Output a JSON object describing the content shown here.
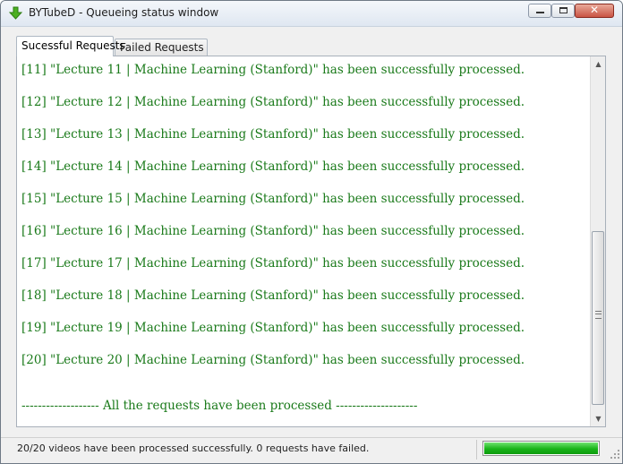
{
  "window": {
    "title": "BYTubeD - Queueing status window",
    "controls": {
      "minimize": "minimize",
      "maximize": "maximize",
      "close": "✕"
    }
  },
  "tabs": [
    {
      "label": "Sucessful Requests",
      "active": true
    },
    {
      "label": "Failed Requests",
      "active": false
    }
  ],
  "log": {
    "lines": [
      "[11] \"Lecture 11 | Machine Learning (Stanford)\" has been successfully processed.",
      "[12] \"Lecture 12 | Machine Learning (Stanford)\" has been successfully processed.",
      "[13] \"Lecture 13 | Machine Learning (Stanford)\" has been successfully processed.",
      "[14] \"Lecture 14 | Machine Learning (Stanford)\" has been successfully processed.",
      "[15] \"Lecture 15 | Machine Learning (Stanford)\" has been successfully processed.",
      "[16] \"Lecture 16 | Machine Learning (Stanford)\" has been successfully processed.",
      "[17] \"Lecture 17 | Machine Learning (Stanford)\" has been successfully processed.",
      "[18] \"Lecture 18 | Machine Learning (Stanford)\" has been successfully processed.",
      "[19] \"Lecture 19 | Machine Learning (Stanford)\" has been successfully processed.",
      "[20] \"Lecture 20 | Machine Learning (Stanford)\" has been successfully processed."
    ],
    "summary": "------------------- All the requests have been processed --------------------",
    "text_color": "#1a7a1a"
  },
  "status": {
    "text": "20/20 videos have been processed successfully. 0 requests have failed.",
    "progress_percent": 100,
    "progress_color": "#18b318"
  },
  "icons": {
    "app": "green-download-arrow-icon",
    "scroll_up": "scroll-up-arrow-icon",
    "scroll_down": "scroll-down-arrow-icon"
  }
}
